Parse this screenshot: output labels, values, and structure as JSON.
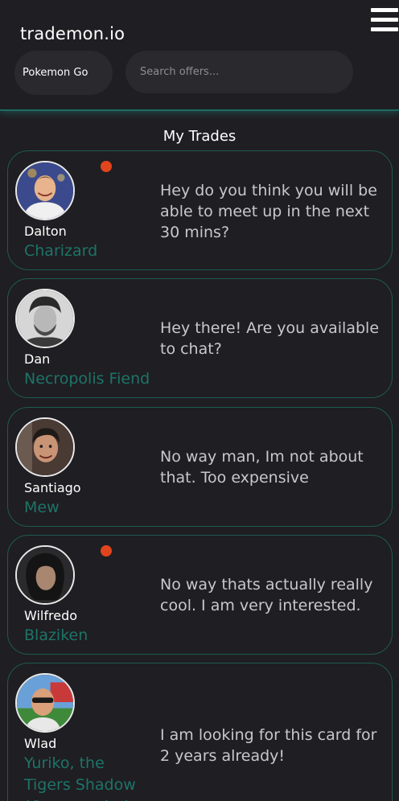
{
  "app": {
    "brand": "trademon.io",
    "game_select": "Pokemon Go",
    "search_placeholder": "Search offers..."
  },
  "section_title": "My Trades",
  "colors": {
    "background": "#1f1e22",
    "accent": "#1d7468",
    "unread": "#e0451d",
    "message_text": "#c8c8cb"
  },
  "trades": [
    {
      "name": "Dalton",
      "item": "Charizard",
      "message": "Hey do you think you will be able to meet up in the next 30 mins?",
      "unread": true,
      "avatar_icon": "avatar-icon"
    },
    {
      "name": "Dan",
      "item": "Necropolis Fiend",
      "message": "Hey there! Are you available to chat?",
      "unread": false,
      "avatar_icon": "avatar-icon"
    },
    {
      "name": "Santiago",
      "item": "Mew",
      "message": "No way man, Im not about that. Too expensive",
      "unread": false,
      "avatar_icon": "avatar-icon"
    },
    {
      "name": "Wilfredo",
      "item": "Blaziken",
      "message": "No way thats actually really cool. I am very interested.",
      "unread": true,
      "avatar_icon": "avatar-icon"
    },
    {
      "name": "Wlad",
      "item": "Yuriko, the Tigers Shadow (Commander)",
      "message": "I am looking for this card for 2 years already!",
      "unread": false,
      "avatar_icon": "avatar-icon"
    }
  ]
}
